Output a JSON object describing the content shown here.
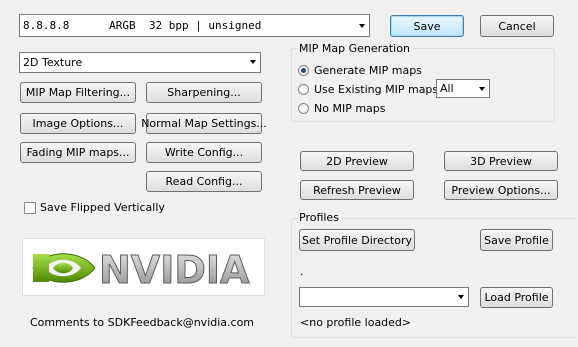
{
  "format_combo": {
    "value": "8.8.8.8      ARGB  32 bpp | unsigned"
  },
  "buttons": {
    "save": "Save",
    "cancel": "Cancel",
    "mip_map_filtering": "MIP Map Filtering...",
    "sharpening": "Sharpening...",
    "image_options": "Image Options...",
    "normal_map_settings": "Normal Map Settings...",
    "fading_mip_maps": "Fading MIP maps...",
    "write_config": "Write Config...",
    "read_config": "Read Config...",
    "preview_2d": "2D Preview",
    "preview_3d": "3D Preview",
    "refresh_preview": "Refresh Preview",
    "preview_options": "Preview Options...",
    "set_profile_directory": "Set Profile Directory",
    "save_profile": "Save Profile",
    "load_profile": "Load Profile"
  },
  "texture_type_combo": {
    "value": "2D Texture"
  },
  "save_flipped": {
    "label": "Save Flipped Vertically",
    "checked": false
  },
  "mip_group": {
    "title": "MIP Map Generation",
    "options": [
      "Generate MIP maps",
      "Use Existing MIP maps",
      "No MIP maps"
    ],
    "selected_index": 0,
    "levels_combo": "All"
  },
  "logo": {
    "text": "NVIDIA"
  },
  "comments": "Comments to SDKFeedback@nvidia.com",
  "profiles": {
    "title": "Profiles",
    "dot": ".",
    "combo_value": "",
    "status": "<no profile loaded>"
  },
  "colors": {
    "nvidia_green": "#76b900",
    "background": "#f0f0f0"
  }
}
